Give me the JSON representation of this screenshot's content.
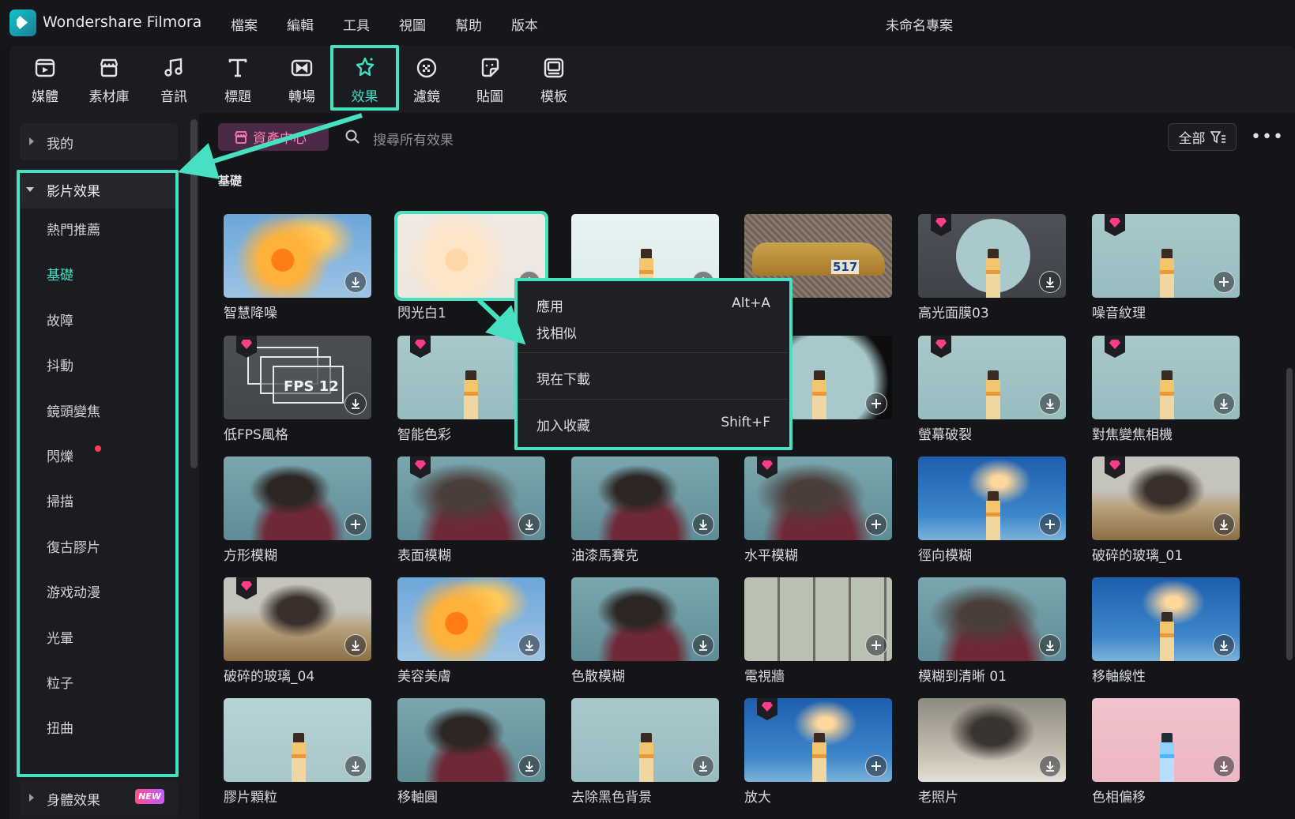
{
  "app": {
    "title": "Wondershare Filmora",
    "project": "未命名專案"
  },
  "menu": [
    "檔案",
    "編輯",
    "工具",
    "視圖",
    "幫助",
    "版本"
  ],
  "toolbar": [
    {
      "label": "媒體",
      "icon": "media-icon"
    },
    {
      "label": "素材庫",
      "icon": "stock-icon"
    },
    {
      "label": "音訊",
      "icon": "music-icon"
    },
    {
      "label": "標題",
      "icon": "title-icon"
    },
    {
      "label": "轉場",
      "icon": "transition-icon"
    },
    {
      "label": "效果",
      "icon": "effects-icon",
      "active": true
    },
    {
      "label": "濾鏡",
      "icon": "filter-icon"
    },
    {
      "label": "貼圖",
      "icon": "sticker-icon"
    },
    {
      "label": "模板",
      "icon": "template-icon"
    }
  ],
  "sidebar": {
    "my": "我的",
    "group": "影片效果",
    "items": [
      "熱門推薦",
      "基礎",
      "故障",
      "抖動",
      "鏡頭變焦",
      "閃爍",
      "掃描",
      "復古膠片",
      "游戏动漫",
      "光暈",
      "粒子",
      "扭曲"
    ],
    "selected": "基礎",
    "body_effects": "身體效果",
    "new_badge": "NEW"
  },
  "search": {
    "asset_center": "資產中心",
    "placeholder": "搜尋所有效果",
    "filter": "全部",
    "more": "•••"
  },
  "section": "基礎",
  "cards": [
    {
      "label": "智慧降噪",
      "art": "flower",
      "action": "download"
    },
    {
      "label": "閃光白1",
      "art": "flower-pale",
      "action": "download",
      "selected": true
    },
    {
      "label": "",
      "art": "light-sky",
      "action": "download"
    },
    {
      "label": "",
      "art": "car",
      "action": "none"
    },
    {
      "label": "高光面膜03",
      "art": "tower-gray",
      "action": "download",
      "premium": true
    },
    {
      "label": "噪音紋理",
      "art": "tower-teal",
      "action": "add",
      "premium": true
    },
    {
      "label": "低FPS風格",
      "art": "fps",
      "action": "download",
      "premium": true
    },
    {
      "label": "智能色彩",
      "art": "tower-teal",
      "action": "download",
      "premium": true
    },
    {
      "label": "",
      "art": "none",
      "action": "none"
    },
    {
      "label": "",
      "art": "tower-dark",
      "action": "add"
    },
    {
      "label": "螢幕破裂",
      "art": "tower-teal",
      "action": "download",
      "premium": true
    },
    {
      "label": "對焦變焦相機",
      "art": "tower-teal",
      "action": "download",
      "premium": true
    },
    {
      "label": "方形模糊",
      "art": "girl",
      "action": "add"
    },
    {
      "label": "表面模糊",
      "art": "girl-blur",
      "action": "download",
      "premium": true
    },
    {
      "label": "油漆馬賽克",
      "art": "girl",
      "action": "download"
    },
    {
      "label": "水平模糊",
      "art": "girl-blur",
      "action": "add",
      "premium": true
    },
    {
      "label": "徑向模糊",
      "art": "blue-tower",
      "action": "add"
    },
    {
      "label": "破碎的玻璃_01",
      "art": "field",
      "action": "download",
      "premium": true
    },
    {
      "label": "破碎的玻璃_04",
      "art": "field",
      "action": "download",
      "premium": true
    },
    {
      "label": "美容美膚",
      "art": "flower",
      "action": "download"
    },
    {
      "label": "色散模糊",
      "art": "girl",
      "action": "download"
    },
    {
      "label": "電視牆",
      "art": "tvwall",
      "action": "add"
    },
    {
      "label": "模糊到清晰 01",
      "art": "girl-blur",
      "action": "download"
    },
    {
      "label": "移軸線性",
      "art": "blue-tower",
      "action": "download"
    },
    {
      "label": "膠片顆粒",
      "art": "grain",
      "action": "download"
    },
    {
      "label": "移軸圓",
      "art": "girl",
      "action": "download"
    },
    {
      "label": "去除黑色背景",
      "art": "tower-teal",
      "action": "download"
    },
    {
      "label": "放大",
      "art": "blue-tower",
      "action": "add",
      "premium": true
    },
    {
      "label": "老照片",
      "art": "old",
      "action": "download"
    },
    {
      "label": "色相偏移",
      "art": "pink",
      "action": "download"
    }
  ],
  "fps_text": "FPS 12",
  "car_text": "517",
  "context_menu": [
    {
      "label": "應用",
      "shortcut": "Alt+A"
    },
    {
      "label": "找相似",
      "shortcut": ""
    },
    {
      "label": "現在下載",
      "shortcut": ""
    },
    {
      "label": "加入收藏",
      "shortcut": "Shift+F"
    }
  ],
  "colors": {
    "accent": "#47e0c1",
    "background": "#141519",
    "panel": "#1b1c21",
    "premium": "#ff3c8a"
  }
}
